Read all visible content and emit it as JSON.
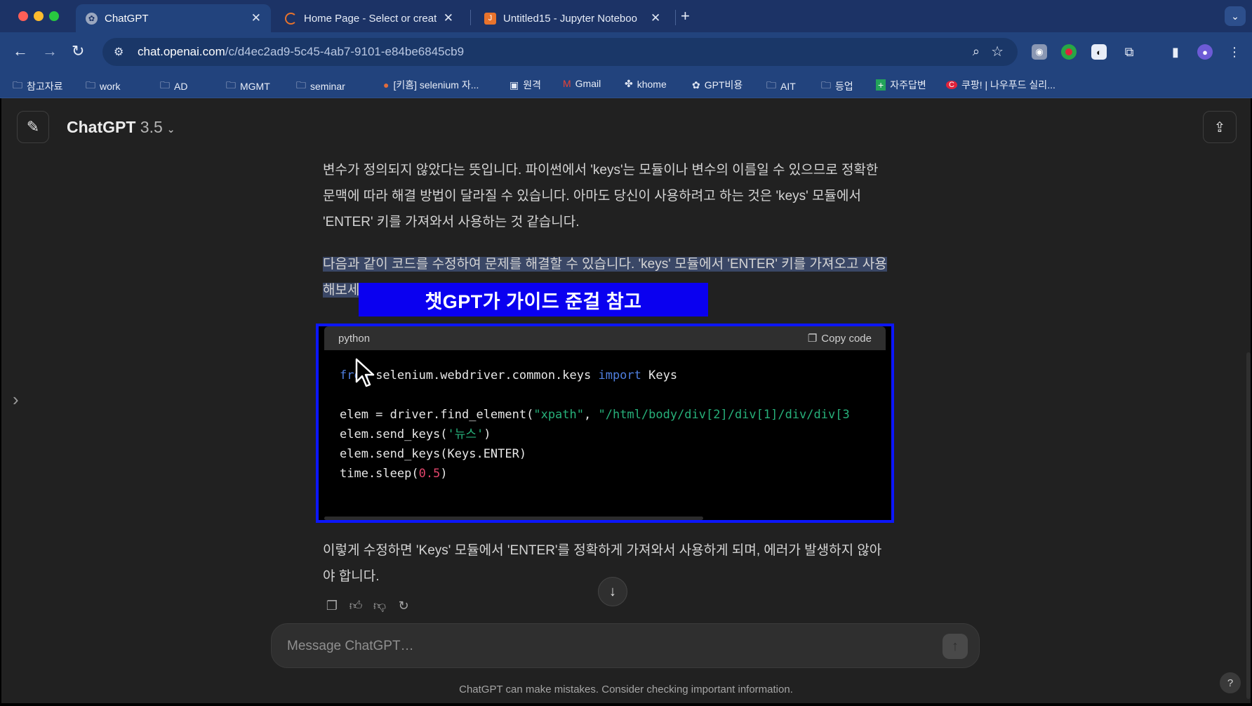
{
  "browser": {
    "tabs": [
      {
        "title": "ChatGPT",
        "icon": "chatgpt-icon",
        "active": true
      },
      {
        "title": "Home Page - Select or create",
        "icon": "jupyter-loading-icon",
        "active": false
      },
      {
        "title": "Untitled15 - Jupyter Noteboo",
        "icon": "jupyter-icon",
        "active": false
      }
    ],
    "new_tab_label": "+",
    "url_host": "chat.openai.com",
    "url_path": "/c/d4ec2ad9-5c45-4ab7-9101-e84be6845cb9",
    "bookmarks": [
      {
        "label": "참고자료",
        "icon": "folder-icon"
      },
      {
        "label": "work",
        "icon": "folder-icon"
      },
      {
        "label": "AD",
        "icon": "folder-icon"
      },
      {
        "label": "MGMT",
        "icon": "folder-icon"
      },
      {
        "label": "seminar",
        "icon": "folder-icon"
      },
      {
        "label": "[키홈] selenium 자...",
        "icon": "site-icon"
      },
      {
        "label": "원격",
        "icon": "remote-icon"
      },
      {
        "label": "Gmail",
        "icon": "gmail-icon"
      },
      {
        "label": "khome",
        "icon": "site-icon"
      },
      {
        "label": "GPT비용",
        "icon": "openai-icon"
      },
      {
        "label": "AIT",
        "icon": "folder-icon"
      },
      {
        "label": "등업",
        "icon": "folder-icon"
      },
      {
        "label": "자주답변",
        "icon": "plus-icon"
      },
      {
        "label": "쿠팡! | 나우푸드 실리...",
        "icon": "coupang-icon"
      }
    ]
  },
  "header": {
    "model_name": "ChatGPT",
    "model_version": "3.5"
  },
  "conversation": {
    "para1": "변수가 정의되지 않았다는 뜻입니다. 파이썬에서 'keys'는 모듈이나 변수의 이름일 수 있으므로 정확한 문맥에 따라 해결 방법이 달라질 수 있습니다. 아마도 당신이 사용하려고 하는 것은 'keys' 모듈에서 'ENTER' 키를 가져와서 사용하는 것 같습니다.",
    "para2": "다음과 같이 코드를 수정하여 문제를 해결할 수 있습니다. 'keys' 모듈에서 'ENTER' 키를 가져오고 사용해보세요.",
    "para3": "이렇게 수정하면 'Keys' 모듈에서 'ENTER'를 정확하게 가져와서 사용하게 되며, 에러가 발생하지 않아야 합니다.",
    "code_lang": "python",
    "copy_label": "Copy code"
  },
  "overlay_banner": "챗GPT가 가이드 준걸 참고",
  "composer": {
    "placeholder": "Message ChatGPT…"
  },
  "disclaimer": "ChatGPT can make mistakes. Consider checking important information.",
  "help_label": "?",
  "colors": {
    "tabbar": "#1c3366",
    "page_bg": "#212121",
    "highlight_box": "#0c16ff",
    "banner": "#0a00f0"
  }
}
